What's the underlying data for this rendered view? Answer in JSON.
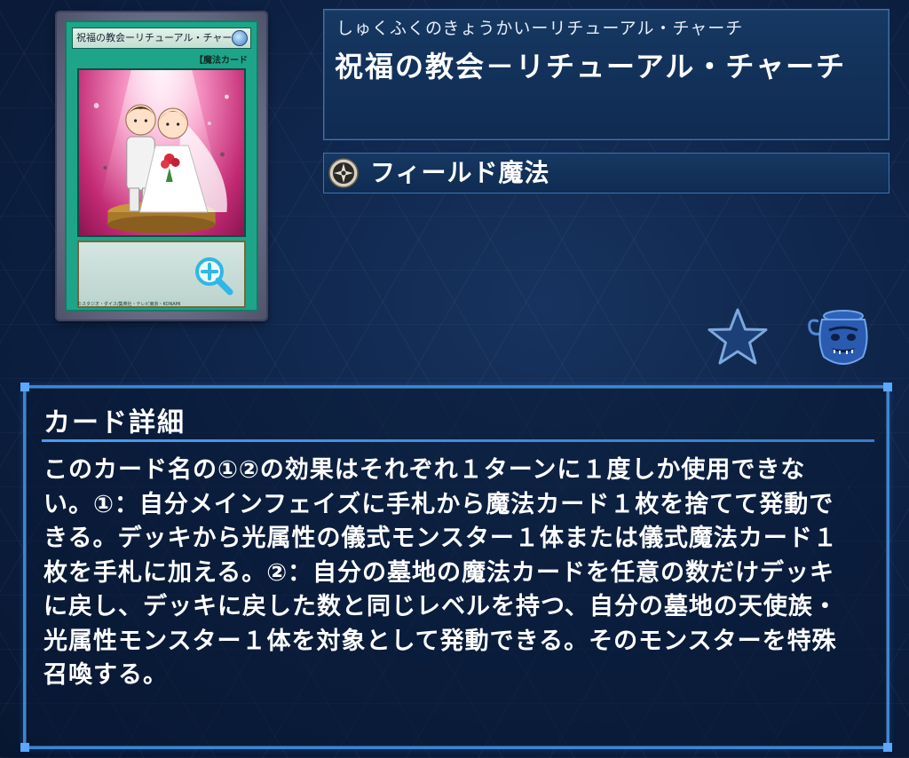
{
  "card": {
    "image_name": "祝福の教会ーリチューアル・チャーチ",
    "image_type_line": "【魔法カード",
    "copyright": "©スタジオ・ダイス/集英社・テレビ東京・KONAMI"
  },
  "title": {
    "reading": "しゅくふくのきょうかいーリチューアル・チャーチ",
    "name": "祝福の教会－リチューアル・チャーチ"
  },
  "type": {
    "label": "フィールド魔法",
    "icon": "field-spell-icon"
  },
  "actions": {
    "favorite_icon": "star-icon",
    "deck_icon": "pot-of-greed-icon",
    "zoom_icon": "zoom-in-icon"
  },
  "detail": {
    "heading": "カード詳細",
    "text": "このカード名の①②の効果はそれぞれ１ターンに１度しか使用できない。①：自分メインフェイズに手札から魔法カード１枚を捨てて発動できる。デッキから光属性の儀式モンスター１体または儀式魔法カード１枚を手札に加える。②：自分の墓地の魔法カードを任意の数だけデッキに戻し、デッキに戻した数と同じレベルを持つ、自分の墓地の天使族・光属性モンスター１体を対象として発動できる。そのモンスターを特殊召喚する。"
  },
  "colors": {
    "background": "#0c1f3e",
    "panel_border": "#3b86d6",
    "spell_card": "#1ea489"
  }
}
